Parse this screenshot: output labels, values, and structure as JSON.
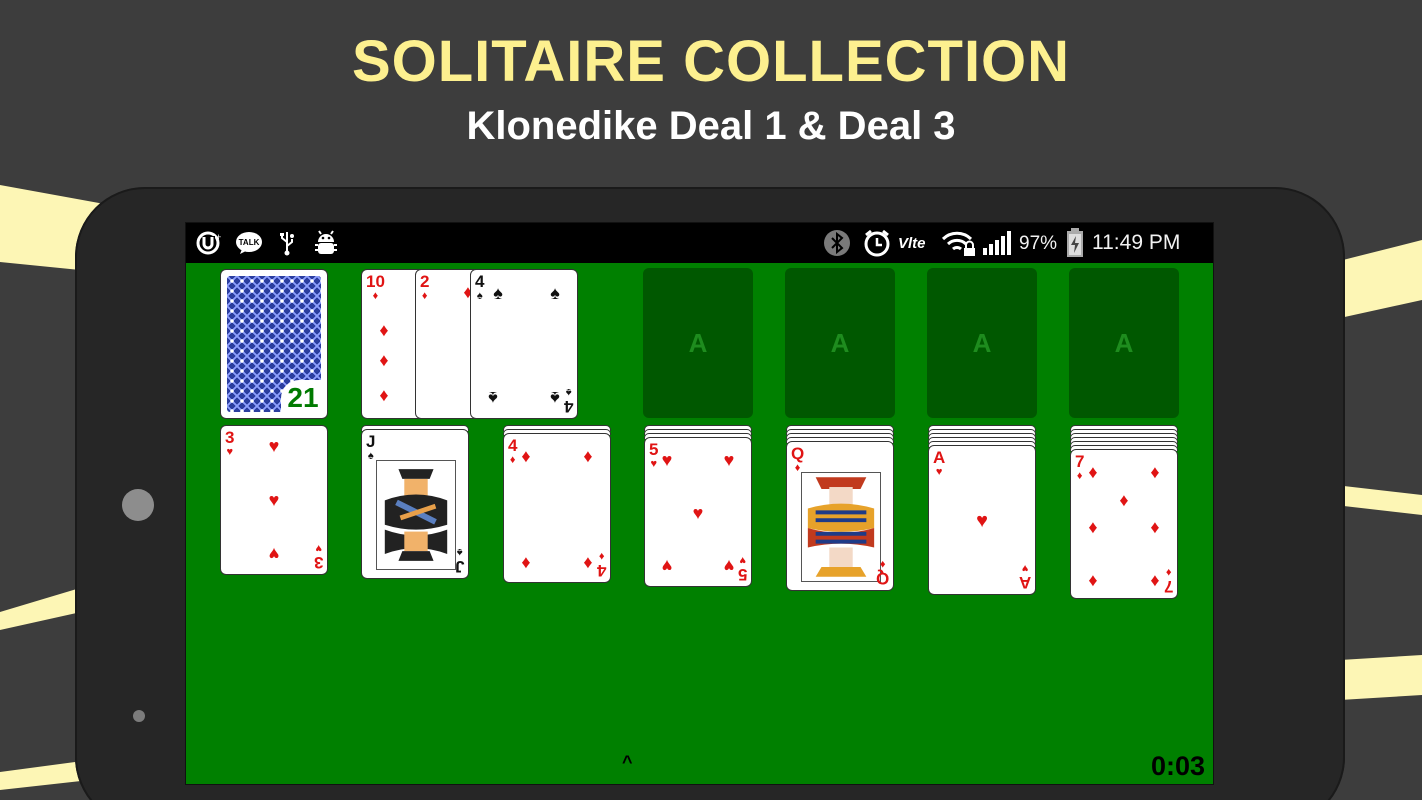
{
  "promo": {
    "title": "SOLITAIRE COLLECTION",
    "subtitle": "Klonedike Deal 1 & Deal 3"
  },
  "colors": {
    "background": "#3d3d3d",
    "title": "#fdf08f",
    "felt": "#008000",
    "foundation": "#005800",
    "card_back": "#2b3d9f",
    "stock_count": "#007a00",
    "red_suit": "#e01414"
  },
  "status_bar": {
    "left_icons": [
      "uplus-icon",
      "kakaotalk-icon",
      "usb-icon",
      "android-debug-icon"
    ],
    "talk_label": "TALK",
    "right_icons": [
      "bluetooth-icon",
      "alarm-icon",
      "volte-icon",
      "wifi-locked-icon",
      "signal-icon",
      "battery-charging-icon"
    ],
    "volte_label": "Vlte",
    "battery": "97%",
    "time": "11:49 PM"
  },
  "game": {
    "stock": {
      "count": "21"
    },
    "waste": [
      {
        "rank": "10",
        "suit": "♦",
        "color": "red"
      },
      {
        "rank": "2",
        "suit": "♦",
        "color": "red"
      },
      {
        "rank": "4",
        "suit": "♠",
        "color": "black"
      }
    ],
    "foundations": [
      {
        "label": "A"
      },
      {
        "label": "A"
      },
      {
        "label": "A"
      },
      {
        "label": "A"
      }
    ],
    "tableau": [
      {
        "hidden": 0,
        "top": {
          "rank": "3",
          "suit": "♥",
          "color": "red"
        }
      },
      {
        "hidden": 1,
        "top": {
          "rank": "J",
          "suit": "♠",
          "color": "black"
        }
      },
      {
        "hidden": 2,
        "top": {
          "rank": "4",
          "suit": "♦",
          "color": "red"
        }
      },
      {
        "hidden": 3,
        "top": {
          "rank": "5",
          "suit": "♥",
          "color": "red"
        }
      },
      {
        "hidden": 4,
        "top": {
          "rank": "Q",
          "suit": "♦",
          "color": "red"
        }
      },
      {
        "hidden": 5,
        "top": {
          "rank": "A",
          "suit": "♥",
          "color": "red"
        }
      },
      {
        "hidden": 6,
        "top": {
          "rank": "7",
          "suit": "♦",
          "color": "red"
        }
      }
    ],
    "menu_chevron": "^",
    "timer": "0:03"
  }
}
